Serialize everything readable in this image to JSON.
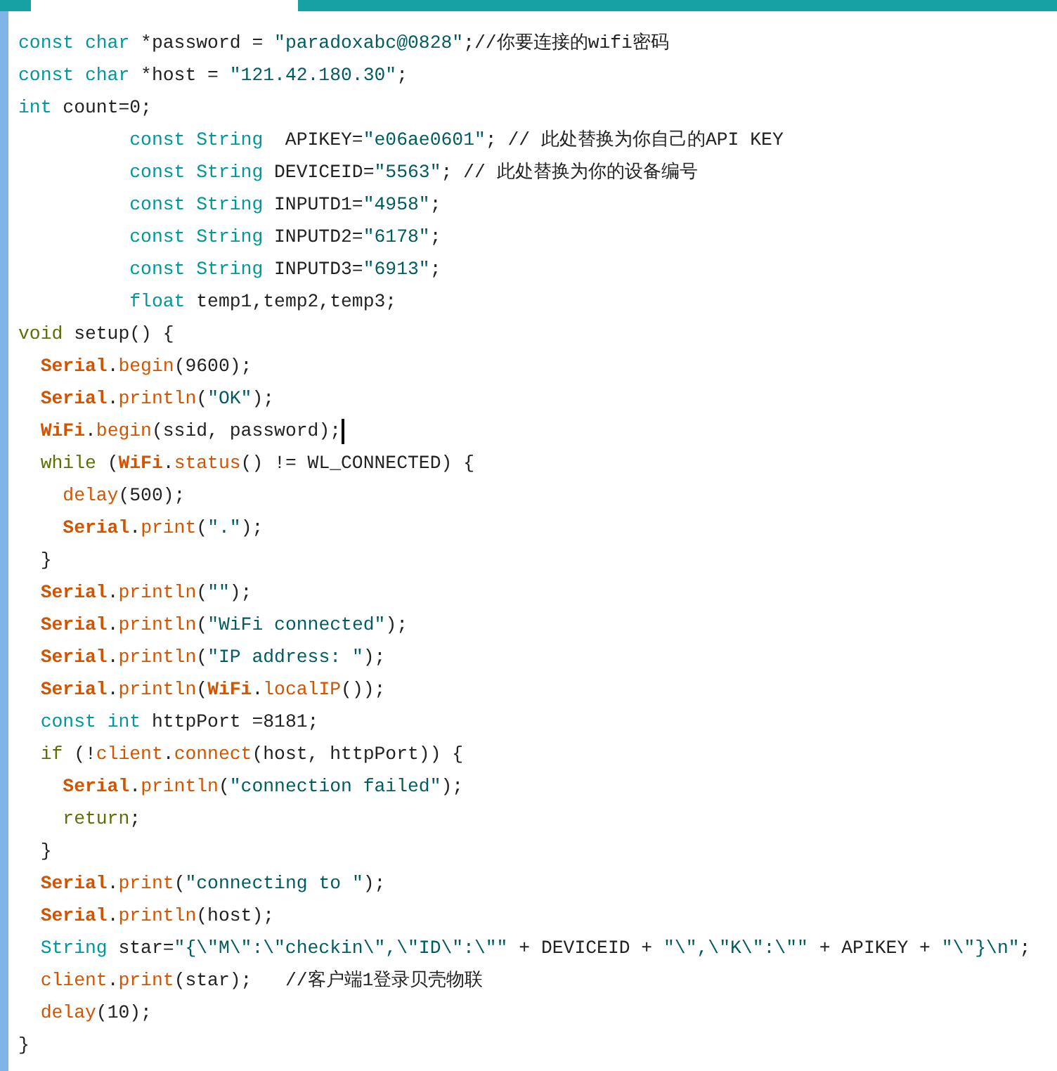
{
  "editor": {
    "lines": [
      {
        "segments": [
          {
            "kind": "keyword",
            "text": "const "
          },
          {
            "kind": "keyword",
            "text": "char"
          },
          {
            "kind": "plain",
            "text": " *password = "
          },
          {
            "kind": "string",
            "text": "\"paradoxabc@0828\""
          },
          {
            "kind": "plain",
            "text": ";//你要连接的wifi密码"
          }
        ]
      },
      {
        "segments": [
          {
            "kind": "keyword",
            "text": "const "
          },
          {
            "kind": "keyword",
            "text": "char"
          },
          {
            "kind": "plain",
            "text": " *host = "
          },
          {
            "kind": "string",
            "text": "\"121.42.180.30\""
          },
          {
            "kind": "plain",
            "text": ";"
          }
        ]
      },
      {
        "segments": [
          {
            "kind": "keyword",
            "text": "int"
          },
          {
            "kind": "plain",
            "text": " count=0;"
          }
        ]
      },
      {
        "segments": [
          {
            "kind": "keyword",
            "text": "          const "
          },
          {
            "kind": "keyword",
            "text": "String"
          },
          {
            "kind": "plain",
            "text": "  APIKEY="
          },
          {
            "kind": "string",
            "text": "\"e06ae0601\""
          },
          {
            "kind": "plain",
            "text": "; // 此处替换为你自己的API KEY"
          }
        ]
      },
      {
        "segments": [
          {
            "kind": "keyword",
            "text": "          const "
          },
          {
            "kind": "keyword",
            "text": "String"
          },
          {
            "kind": "plain",
            "text": " DEVICEID="
          },
          {
            "kind": "string",
            "text": "\"5563\""
          },
          {
            "kind": "plain",
            "text": "; // 此处替换为你的设备编号"
          }
        ]
      },
      {
        "segments": [
          {
            "kind": "keyword",
            "text": "          const "
          },
          {
            "kind": "keyword",
            "text": "String"
          },
          {
            "kind": "plain",
            "text": " INPUTD1="
          },
          {
            "kind": "string",
            "text": "\"4958\""
          },
          {
            "kind": "plain",
            "text": ";"
          }
        ]
      },
      {
        "segments": [
          {
            "kind": "keyword",
            "text": "          const "
          },
          {
            "kind": "keyword",
            "text": "String"
          },
          {
            "kind": "plain",
            "text": " INPUTD2="
          },
          {
            "kind": "string",
            "text": "\"6178\""
          },
          {
            "kind": "plain",
            "text": ";"
          }
        ]
      },
      {
        "segments": [
          {
            "kind": "keyword",
            "text": "          const "
          },
          {
            "kind": "keyword",
            "text": "String"
          },
          {
            "kind": "plain",
            "text": " INPUTD3="
          },
          {
            "kind": "string",
            "text": "\"6913\""
          },
          {
            "kind": "plain",
            "text": ";"
          }
        ]
      },
      {
        "segments": [
          {
            "kind": "keyword",
            "text": "          float"
          },
          {
            "kind": "plain",
            "text": " temp1,temp2,temp3;"
          }
        ]
      },
      {
        "segments": [
          {
            "kind": "control",
            "text": "void"
          },
          {
            "kind": "plain",
            "text": " setup() {"
          }
        ]
      },
      {
        "segments": [
          {
            "kind": "object",
            "text": "  Serial"
          },
          {
            "kind": "plain",
            "text": "."
          },
          {
            "kind": "function",
            "text": "begin"
          },
          {
            "kind": "plain",
            "text": "(9600);"
          }
        ]
      },
      {
        "segments": [
          {
            "kind": "object",
            "text": "  Serial"
          },
          {
            "kind": "plain",
            "text": "."
          },
          {
            "kind": "function",
            "text": "println"
          },
          {
            "kind": "plain",
            "text": "("
          },
          {
            "kind": "string",
            "text": "\"OK\""
          },
          {
            "kind": "plain",
            "text": ");"
          }
        ]
      },
      {
        "caret": true,
        "segments": [
          {
            "kind": "object",
            "text": "  WiFi"
          },
          {
            "kind": "plain",
            "text": "."
          },
          {
            "kind": "function",
            "text": "begin"
          },
          {
            "kind": "plain",
            "text": "(ssid, password);"
          }
        ]
      },
      {
        "segments": [
          {
            "kind": "control",
            "text": "  while"
          },
          {
            "kind": "plain",
            "text": " ("
          },
          {
            "kind": "object",
            "text": "WiFi"
          },
          {
            "kind": "plain",
            "text": "."
          },
          {
            "kind": "function",
            "text": "status"
          },
          {
            "kind": "plain",
            "text": "() != WL_CONNECTED) {"
          }
        ]
      },
      {
        "segments": [
          {
            "kind": "function",
            "text": "    delay"
          },
          {
            "kind": "plain",
            "text": "(500);"
          }
        ]
      },
      {
        "segments": [
          {
            "kind": "object",
            "text": "    Serial"
          },
          {
            "kind": "plain",
            "text": "."
          },
          {
            "kind": "function",
            "text": "print"
          },
          {
            "kind": "plain",
            "text": "("
          },
          {
            "kind": "string",
            "text": "\".\""
          },
          {
            "kind": "plain",
            "text": ");"
          }
        ]
      },
      {
        "segments": [
          {
            "kind": "plain",
            "text": "  }"
          }
        ]
      },
      {
        "segments": [
          {
            "kind": "object",
            "text": "  Serial"
          },
          {
            "kind": "plain",
            "text": "."
          },
          {
            "kind": "function",
            "text": "println"
          },
          {
            "kind": "plain",
            "text": "("
          },
          {
            "kind": "string",
            "text": "\"\""
          },
          {
            "kind": "plain",
            "text": ");"
          }
        ]
      },
      {
        "segments": [
          {
            "kind": "object",
            "text": "  Serial"
          },
          {
            "kind": "plain",
            "text": "."
          },
          {
            "kind": "function",
            "text": "println"
          },
          {
            "kind": "plain",
            "text": "("
          },
          {
            "kind": "string",
            "text": "\"WiFi connected\""
          },
          {
            "kind": "plain",
            "text": ");"
          }
        ]
      },
      {
        "segments": [
          {
            "kind": "object",
            "text": "  Serial"
          },
          {
            "kind": "plain",
            "text": "."
          },
          {
            "kind": "function",
            "text": "println"
          },
          {
            "kind": "plain",
            "text": "("
          },
          {
            "kind": "string",
            "text": "\"IP address: \""
          },
          {
            "kind": "plain",
            "text": ");"
          }
        ]
      },
      {
        "segments": [
          {
            "kind": "object",
            "text": "  Serial"
          },
          {
            "kind": "plain",
            "text": "."
          },
          {
            "kind": "function",
            "text": "println"
          },
          {
            "kind": "plain",
            "text": "("
          },
          {
            "kind": "object",
            "text": "WiFi"
          },
          {
            "kind": "plain",
            "text": "."
          },
          {
            "kind": "function",
            "text": "localIP"
          },
          {
            "kind": "plain",
            "text": "());"
          }
        ]
      },
      {
        "segments": [
          {
            "kind": "keyword",
            "text": "  const "
          },
          {
            "kind": "keyword",
            "text": "int"
          },
          {
            "kind": "plain",
            "text": " httpPort =8181;"
          }
        ]
      },
      {
        "segments": [
          {
            "kind": "control",
            "text": "  if"
          },
          {
            "kind": "plain",
            "text": " (!"
          },
          {
            "kind": "function",
            "text": "client"
          },
          {
            "kind": "plain",
            "text": "."
          },
          {
            "kind": "function",
            "text": "connect"
          },
          {
            "kind": "plain",
            "text": "(host, httpPort)) {"
          }
        ]
      },
      {
        "segments": [
          {
            "kind": "object",
            "text": "    Serial"
          },
          {
            "kind": "plain",
            "text": "."
          },
          {
            "kind": "function",
            "text": "println"
          },
          {
            "kind": "plain",
            "text": "("
          },
          {
            "kind": "string",
            "text": "\"connection failed\""
          },
          {
            "kind": "plain",
            "text": ");"
          }
        ]
      },
      {
        "segments": [
          {
            "kind": "control",
            "text": "    return"
          },
          {
            "kind": "plain",
            "text": ";"
          }
        ]
      },
      {
        "segments": [
          {
            "kind": "plain",
            "text": "  }"
          }
        ]
      },
      {
        "segments": [
          {
            "kind": "object",
            "text": "  Serial"
          },
          {
            "kind": "plain",
            "text": "."
          },
          {
            "kind": "function",
            "text": "print"
          },
          {
            "kind": "plain",
            "text": "("
          },
          {
            "kind": "string",
            "text": "\"connecting to \""
          },
          {
            "kind": "plain",
            "text": ");"
          }
        ]
      },
      {
        "segments": [
          {
            "kind": "object",
            "text": "  Serial"
          },
          {
            "kind": "plain",
            "text": "."
          },
          {
            "kind": "function",
            "text": "println"
          },
          {
            "kind": "plain",
            "text": "(host);"
          }
        ]
      },
      {
        "segments": [
          {
            "kind": "keyword",
            "text": "  String"
          },
          {
            "kind": "plain",
            "text": " star="
          },
          {
            "kind": "string",
            "text": "\"{\\\"M\\\":\\\"checkin\\\",\\\"ID\\\":\\\"\""
          },
          {
            "kind": "plain",
            "text": " + DEVICEID + "
          },
          {
            "kind": "string",
            "text": "\"\\\",\\\"K\\\":\\\"\""
          },
          {
            "kind": "plain",
            "text": " + APIKEY + "
          },
          {
            "kind": "string",
            "text": "\"\\\"}\\n\""
          },
          {
            "kind": "plain",
            "text": ";"
          }
        ]
      },
      {
        "segments": [
          {
            "kind": "function",
            "text": "  client"
          },
          {
            "kind": "plain",
            "text": "."
          },
          {
            "kind": "function",
            "text": "print"
          },
          {
            "kind": "plain",
            "text": "(star);   //客户端1登录贝壳物联"
          }
        ]
      },
      {
        "segments": [
          {
            "kind": "function",
            "text": "  delay"
          },
          {
            "kind": "plain",
            "text": "(10);"
          }
        ]
      },
      {
        "segments": [
          {
            "kind": "plain",
            "text": "}"
          }
        ]
      }
    ]
  }
}
